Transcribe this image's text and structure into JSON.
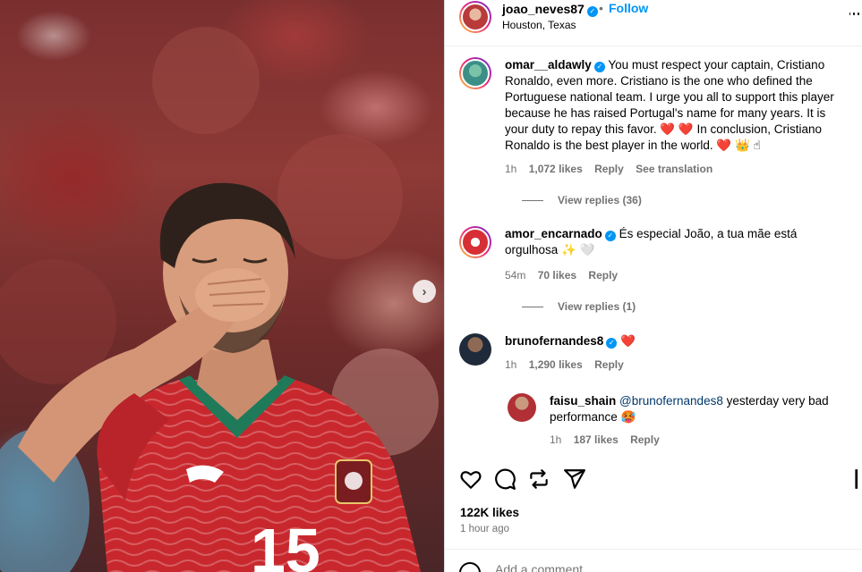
{
  "post": {
    "header": {
      "username": "joao_neves87",
      "separator": "•",
      "follow_label": "Follow",
      "location": "Houston, Texas",
      "avatar": "player-photo"
    },
    "photo": {
      "description_icon": "soccer-player-blowing-kiss",
      "jersey_number": "15",
      "next_icon": "›"
    },
    "comments": [
      {
        "username": "omar__aldawly",
        "verified": true,
        "text": "You must respect your captain, Cristiano Ronaldo, even more. Cristiano is the one who defined the Portuguese national team. I urge you all to support this player because he has raised Portugal's name for many years. It is your duty to repay this favor. ",
        "emoji_1": "❤️ ❤️",
        "text_2": " In conclusion, Cristiano Ronaldo is the best player in the world. ",
        "emoji_2": "❤️ 👑 ☝",
        "time": "1h",
        "likes": "1,072 likes",
        "reply": "Reply",
        "translate": "See translation",
        "view_replies": "View replies (36)"
      },
      {
        "username": "amor_encarnado",
        "verified": true,
        "text": "És especial João, a tua mãe está orgulhosa",
        "emoji": "✨ 🤍",
        "time": "54m",
        "likes": "70 likes",
        "reply": "Reply",
        "view_replies": "View replies (1)"
      },
      {
        "username": "brunofernandes8",
        "verified": true,
        "emoji": "❤️",
        "time": "1h",
        "likes": "1,290 likes",
        "reply": "Reply"
      },
      {
        "username": "faisu_shain",
        "verified": false,
        "mention": "@brunofernandes8",
        "text": " yesterday very bad performance ",
        "emoji": "🥵",
        "time": "1h",
        "likes": "187 likes",
        "reply": "Reply"
      }
    ],
    "actions": {
      "like_icon": "heart-icon",
      "comment_icon": "comment-icon",
      "repost_icon": "repost-icon",
      "share_icon": "share-icon",
      "save_icon": "bookmark-icon"
    },
    "likes_count": "122K likes",
    "time_ago": "1 hour ago",
    "add_comment_placeholder": "Add a comment..."
  },
  "colors": {
    "accent": "#0095f6",
    "text_secondary": "#737373",
    "heart": "#ed4956",
    "jersey_red": "#c8282d",
    "jersey_green": "#1f7a5a"
  }
}
